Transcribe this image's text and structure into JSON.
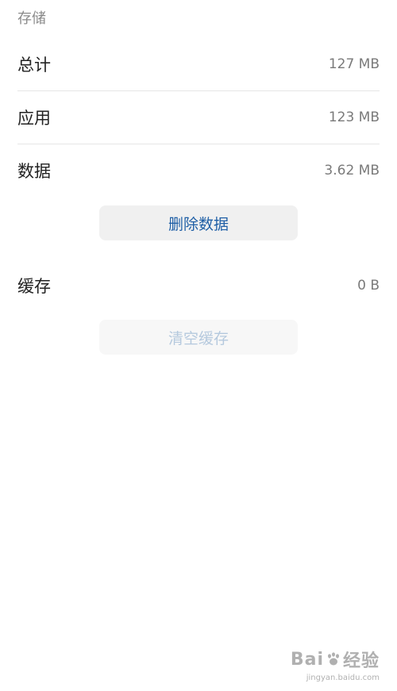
{
  "section": {
    "title": "存储"
  },
  "rows": {
    "total": {
      "label": "总计",
      "value": "127 MB"
    },
    "app": {
      "label": "应用",
      "value": "123 MB"
    },
    "data": {
      "label": "数据",
      "value": "3.62 MB"
    },
    "cache": {
      "label": "缓存",
      "value": "0 B"
    }
  },
  "buttons": {
    "delete_data": "删除数据",
    "clear_cache": "清空缓存"
  },
  "colors": {
    "accent": "#1f5fa6",
    "disabled_text": "#b5c9de"
  },
  "watermark": {
    "brand_left": "Bai",
    "brand_right": "经验",
    "url": "jingyan.baidu.com"
  }
}
